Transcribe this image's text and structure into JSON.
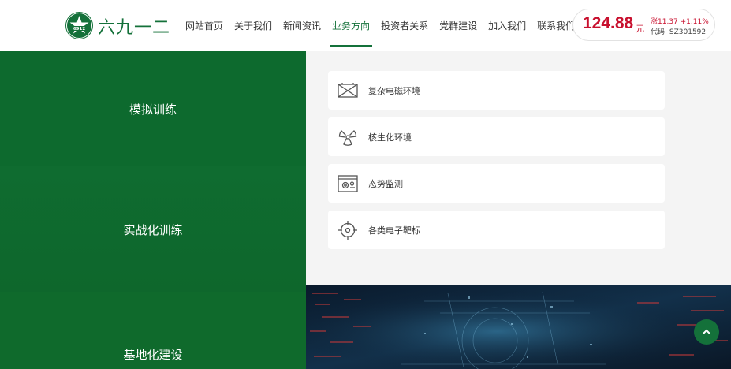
{
  "brand": {
    "name": "六九一二",
    "logo_icon": "star-badge-icon",
    "color": "#14713a"
  },
  "nav": {
    "items": [
      {
        "label": "网站首页",
        "active": false
      },
      {
        "label": "关于我们",
        "active": false
      },
      {
        "label": "新闻资讯",
        "active": false
      },
      {
        "label": "业务方向",
        "active": true
      },
      {
        "label": "投资者关系",
        "active": false
      },
      {
        "label": "党群建设",
        "active": false
      },
      {
        "label": "加入我们",
        "active": false
      },
      {
        "label": "联系我们",
        "active": false
      }
    ]
  },
  "stock": {
    "price": "124.88",
    "unit": "元",
    "change": "涨11.37 +1.11%",
    "code": "代码: SZ301592",
    "color": "#c8102e"
  },
  "panels": [
    {
      "label": "模拟训练"
    },
    {
      "label": "实战化训练"
    },
    {
      "label": "基地化建设"
    }
  ],
  "categories": [
    {
      "label": "复杂电磁环境",
      "icon": "electromagnetic-box-icon"
    },
    {
      "label": "核生化环境",
      "icon": "radiation-icon"
    },
    {
      "label": "态势监测",
      "icon": "monitor-gear-icon"
    },
    {
      "label": "各类电子靶标",
      "icon": "crosshair-target-icon"
    }
  ],
  "colors": {
    "panel_green": "#0d6a2e",
    "accent": "#14713a",
    "background": "#f4f4f4"
  },
  "back_to_top": {
    "icon": "chevron-up-icon"
  }
}
